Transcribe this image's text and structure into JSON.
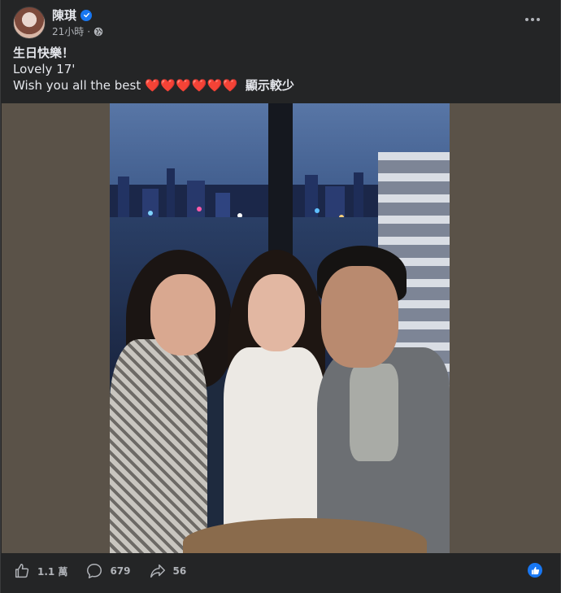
{
  "post": {
    "author_name": "陳琪",
    "timestamp": "21小時",
    "meta_separator": "·",
    "verified": true,
    "privacy_icon": "globe-icon",
    "more_icon": "more-options-icon",
    "caption_line1": "生日快樂！",
    "caption_line2": "Lovely 17'",
    "caption_line3_text": "Wish you all the best",
    "caption_line3_emojis": "❤️❤️❤️❤️❤️❤️",
    "see_more_label": "顯示較少"
  },
  "actions": {
    "like_icon": "thumbs-up-icon",
    "like_count": "1.1 萬",
    "comment_icon": "comment-bubble-icon",
    "comment_count": "679",
    "share_icon": "share-arrow-icon",
    "share_count": "56",
    "reaction_icon": "like-reaction-icon"
  },
  "colors": {
    "background": "#242526",
    "text_primary": "#e4e6eb",
    "text_secondary": "#b0b3b8",
    "accent": "#1877f2",
    "heart": "#e8243a"
  }
}
